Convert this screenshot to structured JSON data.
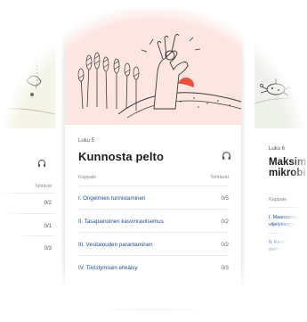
{
  "left_card": {
    "col_header": "Tehtävät",
    "rows": [
      "0/2",
      "0/1",
      "0/3"
    ]
  },
  "main_card": {
    "lesson_number": "Luku 5",
    "title": "Kunnosta pelto",
    "col_chapter": "Kappale",
    "col_tasks": "Tehtävät",
    "rows": [
      {
        "title": "I. Ongelmien tunnistaminen",
        "tasks": "0/5"
      },
      {
        "title": "II. Tasapainoinen kasvinravitsemus",
        "tasks": "0/2"
      },
      {
        "title": "III. Vesitalouden parantaminen",
        "tasks": "0/2"
      },
      {
        "title": "IV. Tiivistymisen ehkäisy",
        "tasks": "0/3"
      }
    ]
  },
  "right_card": {
    "lesson_number": "Luku 6",
    "title_line1": "Maksim",
    "title_line2": "mikrobi",
    "col_chapter": "Kappale",
    "rows": [
      {
        "line1": "I. Maanparan",
        "line2": "viljelykierron"
      },
      {
        "line1": "II. Kerää/",
        "line2": "sekä tr"
      }
    ]
  },
  "icons": {
    "headphone": "headphones-icon"
  },
  "colors": {
    "main_art_bg": "#fde5e1",
    "link_blue": "#1f4b8f",
    "sun": "#e8503a"
  }
}
